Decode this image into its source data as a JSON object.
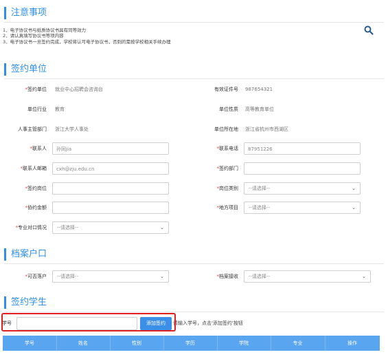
{
  "notice": {
    "title": "注意事项",
    "lines": [
      "1、电子协议书与纸质协议书具有同等效力",
      "2、请认真填写协议书等项内容",
      "3、电子协议书一旦签约完成，学校将认可电子协议书，否则的需按学校相关手续办理"
    ]
  },
  "signing_unit": {
    "title": "签约单位",
    "fields": {
      "unit_name": {
        "label": "签约单位",
        "value": "就业中心招聘会咨询台"
      },
      "license_no": {
        "label": "有效证件号",
        "value": "987654321"
      },
      "industry": {
        "label": "单位行业",
        "value": "教育"
      },
      "nature": {
        "label": "单位性质",
        "value": "高等教育单位"
      },
      "hr_dept": {
        "label": "人事主管部门",
        "value": "浙江大学人事处"
      },
      "location": {
        "label": "单位所在地",
        "value": "浙江省杭州市西湖区"
      },
      "contact": {
        "label": "联系人",
        "value": "孙同jia"
      },
      "phone": {
        "label": "联系电话",
        "value": "87951226"
      },
      "email": {
        "label": "联系人邮箱",
        "value": "cxh@zju.edu.cn"
      },
      "dept": {
        "label": "签约部门",
        "value": ""
      },
      "position": {
        "label": "签约岗位",
        "value": ""
      },
      "position_type": {
        "label": "岗位类别",
        "value": "--请选择--"
      },
      "salary": {
        "label": "协约金额",
        "value": ""
      },
      "project": {
        "label": "地方项目",
        "value": "--请选择--"
      },
      "major_match": {
        "label": "专业对口情况",
        "value": "--请选择--"
      }
    }
  },
  "archive": {
    "title": "档案户口",
    "settle": {
      "label": "可否落户",
      "value": "--请选择--"
    },
    "receive": {
      "label": "档案接收",
      "value": "--请选择--"
    }
  },
  "students": {
    "title": "签约学生",
    "student_no_label": "学号",
    "student_no_value": "",
    "add_button": "添加签约",
    "hint": "请输入学号，点击'添加签约'按钮",
    "columns": [
      "学号",
      "姓名",
      "性别",
      "学历",
      "学院",
      "专业",
      "操作"
    ]
  },
  "colors": {
    "accent": "#2f8fe6",
    "table_header": "#5aa5ef",
    "highlight": "#e02020"
  }
}
